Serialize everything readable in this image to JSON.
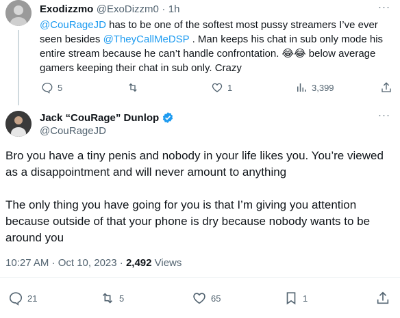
{
  "first_tweet": {
    "author_name": "Exodizzmo",
    "author_handle": "@ExoDizzm0",
    "separator": "·",
    "time": "1h",
    "more": "···",
    "mention_1": "@CouRageJD",
    "text_1": " has to be one of the softest most pussy streamers I’ve ever seen besides ",
    "mention_2": "@TheyCallMeDSP",
    "text_2": " . Man keeps his chat in sub only mode his entire stream because he can’t handle confrontation. 😂😂 below average gamers keeping their chat in sub only. Crazy",
    "replies": "5",
    "likes": "1",
    "views": "3,399"
  },
  "reply_tweet": {
    "author_name": "Jack “CouRage” Dunlop",
    "author_handle": "@CouRageJD",
    "more": "···",
    "paragraph_1": "Bro you have a tiny penis and nobody in your life likes you. You’re viewed as a disappointment and will never amount to anything",
    "paragraph_2": "The only thing you have going for you is that I’m giving you attention because outside of that your phone is dry because nobody wants to be around you",
    "timestamp": "10:27 AM · Oct 10, 2023 · ",
    "views_count": "2,492",
    "views_label": " Views",
    "replies": "21",
    "retweets": "5",
    "likes": "65",
    "bookmarks": "1"
  },
  "colors": {
    "accent": "#1d9bf0",
    "text": "#0f1419",
    "muted": "#536471",
    "divider": "#eff3f4"
  }
}
